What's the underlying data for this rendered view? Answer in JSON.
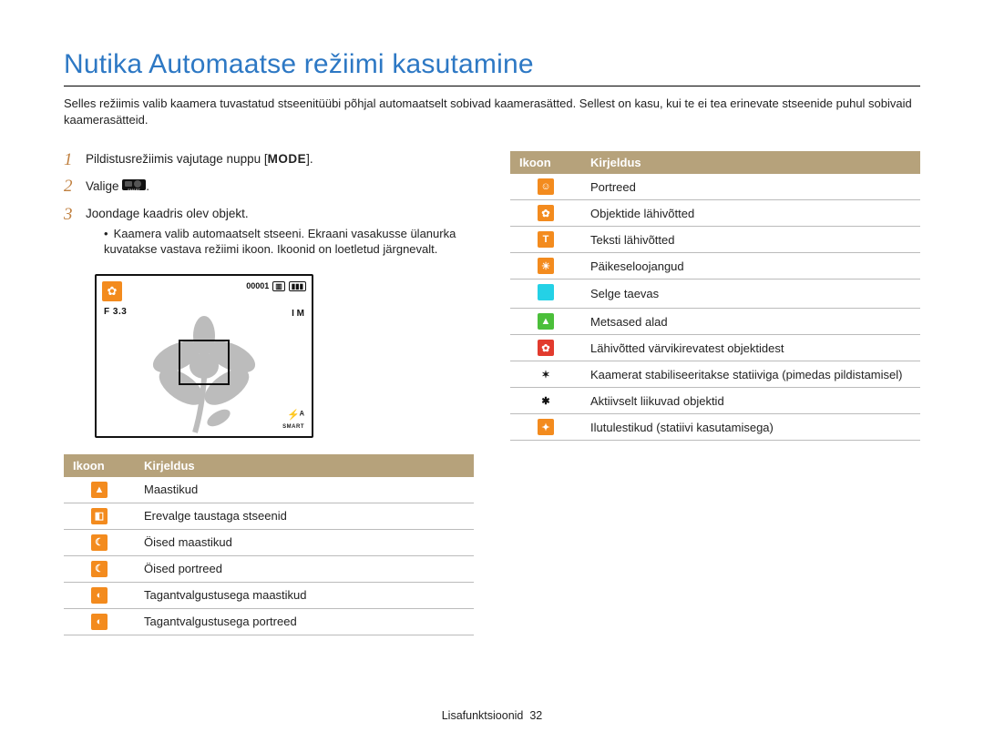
{
  "title": "Nutika Automaatse režiimi kasutamine",
  "intro": "Selles režiimis valib kaamera tuvastatud stseenitüübi põhjal automaatselt sobivad kaamerasätted. Sellest on kasu, kui te ei tea erinevate stseenide puhul sobivaid kaamerasätteid.",
  "steps": {
    "s1_pre": "Pildistusrežiimis vajutage nuppu [",
    "s1_mode": "MODE",
    "s1_post": "].",
    "s2": "Valige",
    "s3": "Joondage kaadris olev objekt.",
    "s3_sub": "Kaamera valib automaatselt stseeni. Ekraani vasakusse ülanurka kuvatakse vastava režiimi ikoon. Ikoonid on loetletud järgnevalt."
  },
  "screen": {
    "f": "F 3.3",
    "counter": "00001",
    "im": "I M",
    "flash": "⚡ᴬ",
    "smart": "SMART"
  },
  "headers": {
    "icon": "Ikoon",
    "desc": "Kirjeldus"
  },
  "left": [
    {
      "cls": "o",
      "glyph": "▲",
      "text": "Maastikud"
    },
    {
      "cls": "o",
      "glyph": "◧",
      "text": "Erevalge taustaga stseenid"
    },
    {
      "cls": "o",
      "glyph": "☾",
      "text": "Öised maastikud"
    },
    {
      "cls": "o",
      "glyph": "☾",
      "text": "Öised portreed"
    },
    {
      "cls": "o",
      "glyph": "◐",
      "text": "Tagantvalgustusega maastikud"
    },
    {
      "cls": "o",
      "glyph": "◐",
      "text": "Tagantvalgustusega portreed"
    }
  ],
  "right": [
    {
      "cls": "o",
      "glyph": "☺",
      "text": "Portreed"
    },
    {
      "cls": "o",
      "glyph": "✿",
      "text": "Objektide lähivõtted"
    },
    {
      "cls": "o",
      "glyph": "T",
      "text": "Teksti lähivõtted"
    },
    {
      "cls": "o",
      "glyph": "☀",
      "text": "Päikeseloojangud"
    },
    {
      "cls": "c",
      "glyph": "",
      "text": "Selge taevas"
    },
    {
      "cls": "g",
      "glyph": "▲",
      "text": "Metsased alad"
    },
    {
      "cls": "r",
      "glyph": "✿",
      "text": "Lähivõtted värvikirevatest objektidest"
    },
    {
      "cls": "w",
      "glyph": "✶",
      "text": "Kaamerat stabiliseeritakse statiiviga (pimedas pildistamisel)"
    },
    {
      "cls": "w",
      "glyph": "✱",
      "text": "Aktiivselt liikuvad objektid"
    },
    {
      "cls": "o",
      "glyph": "✦",
      "text": "Ilutulestikud (statiivi kasutamisega)"
    }
  ],
  "footer": {
    "section": "Lisafunktsioonid",
    "page": "32"
  }
}
